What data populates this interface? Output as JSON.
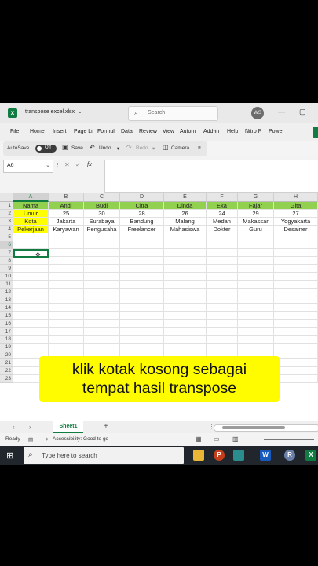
{
  "title_bar": {
    "filename": "transpose excel.xlsx",
    "search_placeholder": "Search",
    "user_initials": "WS",
    "minimize": "—",
    "maximize": "▢"
  },
  "menu": [
    "File",
    "Home",
    "Insert",
    "Page Li",
    "Formul",
    "Data",
    "Review",
    "View",
    "Autom",
    "Add-in",
    "Help",
    "Nitro P",
    "Power"
  ],
  "quick_access": {
    "autosave": "AutoSave",
    "autosave_state": "Off",
    "save": "Save",
    "undo": "Undo",
    "redo": "Redo",
    "camera": "Camera"
  },
  "formula_bar": {
    "name_box": "A6",
    "fx": "fx"
  },
  "sheet": {
    "columns": [
      "A",
      "B",
      "C",
      "D",
      "E",
      "F",
      "G",
      "H"
    ],
    "selected_column": "A",
    "selected_row": "6",
    "rows": [
      [
        "Nama",
        "Andi",
        "Budi",
        "Citra",
        "Dinda",
        "Eka",
        "Fajar",
        "Gita"
      ],
      [
        "Umur",
        "25",
        "30",
        "28",
        "26",
        "24",
        "29",
        "27"
      ],
      [
        "Kota",
        "Jakarta",
        "Surabaya",
        "Bandung",
        "Malang",
        "Medan",
        "Makassar",
        "Yogyakarta"
      ],
      [
        "Pekerjaan",
        "Karyawan",
        "Pengusaha",
        "Freelancer",
        "Mahasiswa",
        "Dokter",
        "Guru",
        "Desainer"
      ]
    ],
    "row_numbers": [
      "1",
      "2",
      "3",
      "4",
      "5",
      "6",
      "7",
      "8",
      "9",
      "10",
      "11",
      "12",
      "13",
      "14",
      "15",
      "16",
      "17",
      "18",
      "19",
      "20",
      "21",
      "22",
      "23"
    ]
  },
  "caption": {
    "line1": "klik kotak kosong sebagai",
    "line2": "tempat hasil transpose"
  },
  "sheet_tabs": {
    "active": "Sheet1",
    "add": "+"
  },
  "status": {
    "ready": "Ready",
    "accessibility": "Accessibility: Good to go"
  },
  "taskbar": {
    "search_placeholder": "Type here to search"
  },
  "colors": {
    "header_row": "#92d050",
    "label_column": "#ffff00",
    "excel_green": "#107c41",
    "caption_bg": "#fffc00"
  }
}
